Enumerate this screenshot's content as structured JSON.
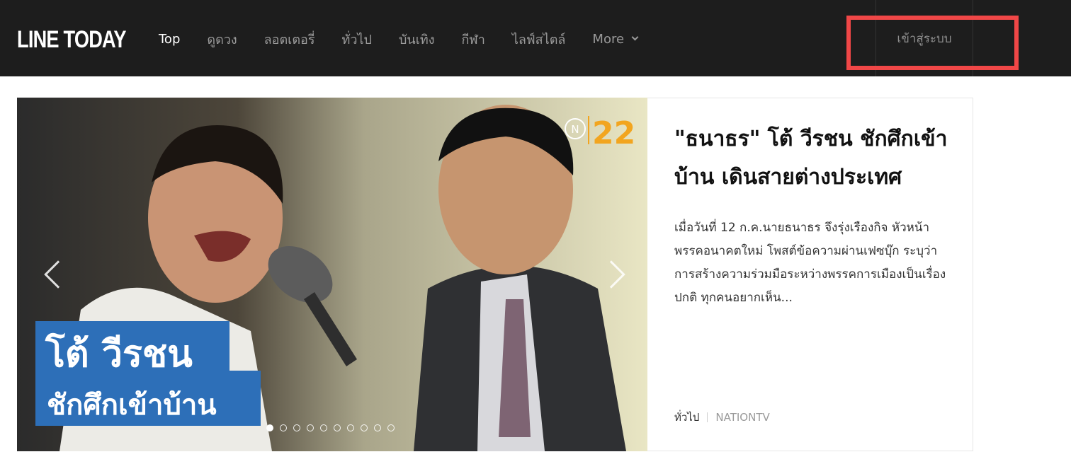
{
  "header": {
    "logo": "LINE TODAY",
    "nav": [
      "Top",
      "ดูดวง",
      "ลอตเตอรี่",
      "ทั่วไป",
      "บันเทิง",
      "กีฬา",
      "ไลฟ์สไตล์"
    ],
    "more": "More",
    "login": "เข้าสู่ระบบ"
  },
  "hero": {
    "badge_number": "22",
    "overlay_line1": "โต้ วีรชน",
    "overlay_line2": "ชักศึกเข้าบ้าน",
    "slide_count": 10,
    "active_slide": 1
  },
  "article": {
    "title": "\"ธนาธร\" โต้ วีรชน ชักศึกเข้าบ้าน เดินสายต่างประเทศ",
    "summary": "เมื่อวันที่ 12 ก.ค.นายธนาธร จึงรุ่งเรืองกิจ หัวหน้าพรรคอนาคตใหม่ โพสต์ข้อความผ่านเฟซบุ๊ก ระบุว่า การสร้างความร่วมมือระหว่างพรรคการเมืองเป็นเรื่องปกติ ทุกคนอยากเห็น...",
    "category": "ทั่วไป",
    "source": "NATIONTV"
  },
  "colors": {
    "topbar": "#1d1d1d",
    "highlight": "#f04747",
    "overlay_blue": "#2d6fb8",
    "badge_orange": "#f2a51f"
  }
}
